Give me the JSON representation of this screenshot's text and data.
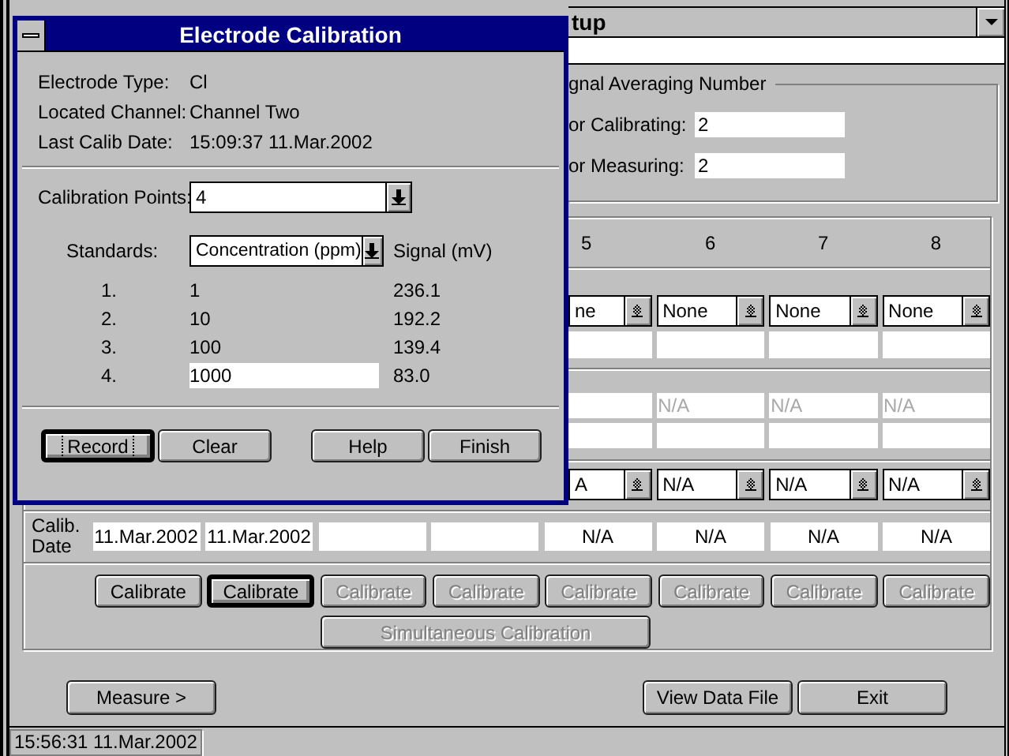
{
  "main_window": {
    "title": "tup"
  },
  "signal_averaging": {
    "label": "gnal Averaging Number",
    "fields": [
      {
        "label": "or Calibrating:",
        "value": "2"
      },
      {
        "label": "or Measuring:",
        "value": "2"
      }
    ]
  },
  "channel_columns": [
    "5",
    "6",
    "7",
    "8"
  ],
  "electrode_selects": [
    {
      "value": "ne"
    },
    {
      "value": "None"
    },
    {
      "value": "None"
    },
    {
      "value": "None"
    }
  ],
  "reading_fields": [
    {
      "kind": "blank"
    },
    {
      "kind": "hint",
      "placeholder": "N/A"
    },
    {
      "kind": "hint",
      "placeholder": "N/A"
    },
    {
      "kind": "hint",
      "placeholder": "N/A"
    }
  ],
  "unit_selects": [
    {
      "value": "A"
    },
    {
      "value": "N/A"
    },
    {
      "value": "N/A"
    },
    {
      "value": "N/A"
    }
  ],
  "calib_date": {
    "label": "Calib. Date",
    "values": [
      {
        "kind": "date",
        "value": "11.Mar.2002"
      },
      {
        "kind": "date",
        "value": "11.Mar.2002"
      },
      {
        "kind": "blank"
      },
      {
        "kind": "blank"
      },
      {
        "kind": "date",
        "value": "N/A"
      },
      {
        "kind": "date",
        "value": "N/A"
      },
      {
        "kind": "date",
        "value": "N/A"
      },
      {
        "kind": "date",
        "value": "N/A"
      }
    ]
  },
  "calibrate_buttons": [
    {
      "label": "Calibrate",
      "disabled": false,
      "focused": false
    },
    {
      "label": "Calibrate",
      "disabled": false,
      "focused": true
    },
    {
      "label": "Calibrate",
      "disabled": true,
      "focused": false
    },
    {
      "label": "Calibrate",
      "disabled": true,
      "focused": false
    },
    {
      "label": "Calibrate",
      "disabled": true,
      "focused": false
    },
    {
      "label": "Calibrate",
      "disabled": true,
      "focused": false
    },
    {
      "label": "Calibrate",
      "disabled": true,
      "focused": false
    },
    {
      "label": "Calibrate",
      "disabled": true,
      "focused": false
    }
  ],
  "simultaneous_button": {
    "label": "Simultaneous Calibration",
    "disabled": true
  },
  "bottom_buttons": [
    {
      "label": "Measure >"
    },
    {
      "label": "View Data File"
    },
    {
      "label": "Exit"
    }
  ],
  "status_bar": "15:56:31 11.Mar.2002",
  "dialog": {
    "title": "Electrode Calibration",
    "info": [
      {
        "label": "Electrode Type:",
        "value": "Cl"
      },
      {
        "label": "Located Channel:",
        "value": "Channel Two"
      },
      {
        "label": "Last Calib Date:",
        "value": "15:09:37 11.Mar.2002"
      }
    ],
    "calibration_points": {
      "label": "Calibration Points:",
      "value": "4"
    },
    "standards": {
      "label": "Standards:",
      "value": "Concentration (ppm)",
      "signal_header": "Signal (mV)"
    },
    "rows": [
      {
        "index": "1.",
        "concentration": "1",
        "signal": "236.1",
        "editing": false
      },
      {
        "index": "2.",
        "concentration": "10",
        "signal": "192.2",
        "editing": false
      },
      {
        "index": "3.",
        "concentration": "100",
        "signal": "139.4",
        "editing": false
      },
      {
        "index": "4.",
        "concentration": "1000",
        "signal": "83.0",
        "editing": true
      }
    ],
    "buttons": [
      {
        "label": "Record",
        "focused": true
      },
      {
        "label": "Clear",
        "focused": false
      },
      {
        "label": "Help",
        "focused": false
      },
      {
        "label": "Finish",
        "focused": false
      }
    ]
  }
}
